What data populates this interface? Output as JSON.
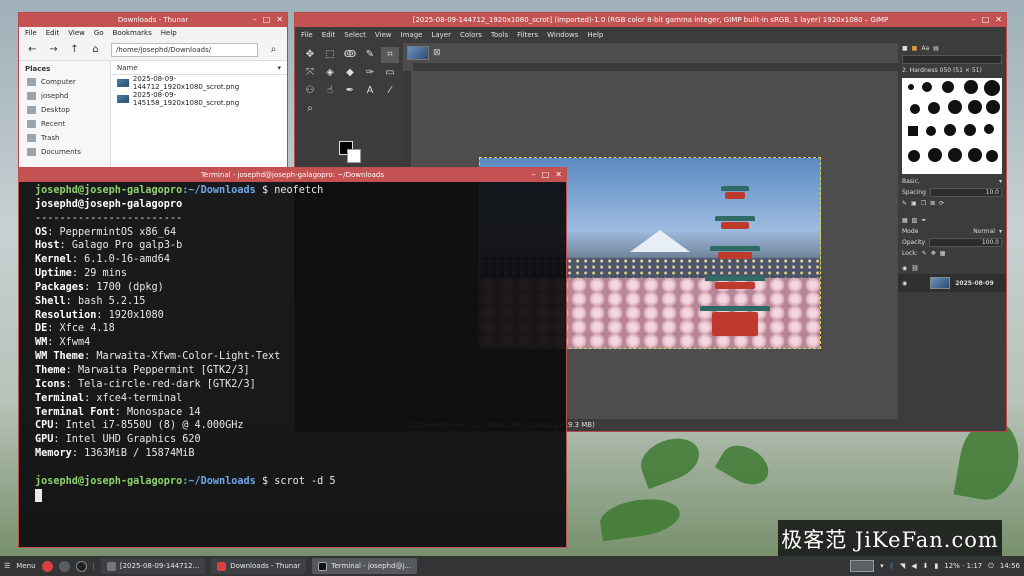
{
  "thunar": {
    "title": "Downloads - Thunar",
    "menu": [
      "File",
      "Edit",
      "View",
      "Go",
      "Bookmarks",
      "Help"
    ],
    "path": "/home/josephd/Downloads/",
    "places_header": "Places",
    "places": [
      "Computer",
      "josephd",
      "Desktop",
      "Recent",
      "Trash",
      "Documents"
    ],
    "column_name": "Name",
    "files": [
      "2025-08-09-144712_1920x1080_scrot.png",
      "2025-08-09-145158_1920x1080_scrot.png"
    ]
  },
  "gimp": {
    "title": "[2025-08-09-144712_1920x1080_scrot] (imported)-1.0 (RGB color 8-bit gamma integer, GIMP built-in sRGB, 1 layer) 1920x1080 – GIMP",
    "menu": [
      "File",
      "Edit",
      "Select",
      "View",
      "Image",
      "Layer",
      "Colors",
      "Tools",
      "Filters",
      "Windows",
      "Help"
    ],
    "status": "2025-08-09-144712_1920x1080_scrot.png (19.3 MB)",
    "dock": {
      "brush_name": "2. Hardness 050 (51 × 51)",
      "preset": "Basic,",
      "spacing_label": "Spacing",
      "spacing_value": "10.0",
      "mode_label": "Mode",
      "mode_value": "Normal",
      "opacity_label": "Opacity",
      "opacity_value": "100.0",
      "lock_label": "Lock:",
      "layer_name": "2025-08-09"
    }
  },
  "terminal": {
    "title": "Terminal - josephd@joseph-galagopro: ~/Downloads",
    "prompt_user": "josephd@joseph-galagopro",
    "prompt_path": ":~/Downloads",
    "cmd1": "$ neofetch",
    "hostline": "josephd@joseph-galagopro",
    "separator": "------------------------",
    "info": [
      {
        "k": "OS",
        "v": ": PeppermintOS x86_64"
      },
      {
        "k": "Host",
        "v": ": Galago Pro galp3-b"
      },
      {
        "k": "Kernel",
        "v": ": 6.1.0-16-amd64"
      },
      {
        "k": "Uptime",
        "v": ": 29 mins"
      },
      {
        "k": "Packages",
        "v": ": 1700 (dpkg)"
      },
      {
        "k": "Shell",
        "v": ": bash 5.2.15"
      },
      {
        "k": "Resolution",
        "v": ": 1920x1080"
      },
      {
        "k": "DE",
        "v": ": Xfce 4.18"
      },
      {
        "k": "WM",
        "v": ": Xfwm4"
      },
      {
        "k": "WM Theme",
        "v": ": Marwaita-Xfwm-Color-Light-Text"
      },
      {
        "k": "Theme",
        "v": ": Marwaita Peppermint [GTK2/3]"
      },
      {
        "k": "Icons",
        "v": ": Tela-circle-red-dark [GTK2/3]"
      },
      {
        "k": "Terminal",
        "v": ": xfce4-terminal"
      },
      {
        "k": "Terminal Font",
        "v": ": Monospace 14"
      },
      {
        "k": "CPU",
        "v": ": Intel i7-8550U (8) @ 4.000GHz"
      },
      {
        "k": "GPU",
        "v": ": Intel UHD Graphics 620"
      },
      {
        "k": "Memory",
        "v": ": 1363MiB / 15874MiB"
      }
    ],
    "cmd2": "$ scrot -d 5"
  },
  "taskbar": {
    "menu_label": "Menu",
    "tasks": [
      "[2025-08-09-144712...",
      "Downloads - Thunar",
      "Terminal - josephd@j..."
    ],
    "battery": "12% · 1:17",
    "clock": "14:56"
  },
  "watermark": "极客范 JiKeFan.com",
  "colors": {
    "frame": "#c45252",
    "prompt": "#8fd36f",
    "path": "#6fa8e8"
  }
}
